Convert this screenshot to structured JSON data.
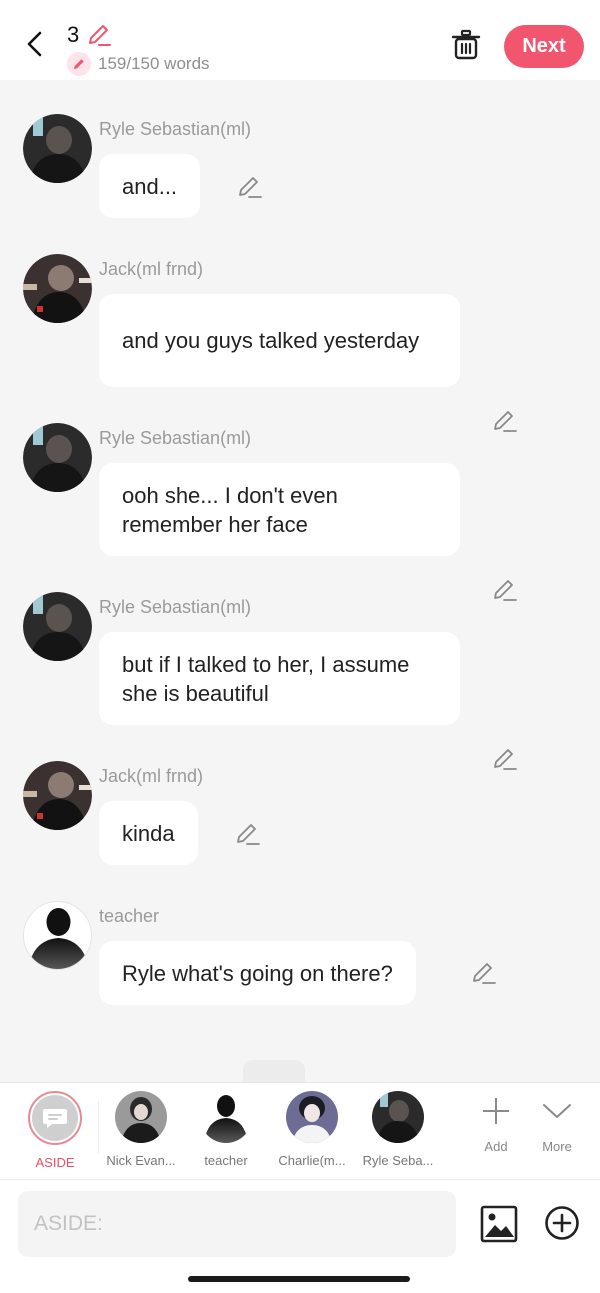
{
  "header": {
    "chapter_number": "3",
    "word_count": "159/150 words",
    "next_label": "Next"
  },
  "messages": [
    {
      "speaker": "Ryle Sebastian(ml)",
      "text": "and...",
      "avatar": "dark-figure-avatar"
    },
    {
      "speaker": "Jack(ml frnd)",
      "text": "and you guys talked yesterday",
      "avatar": "city-figure-avatar"
    },
    {
      "speaker": "Ryle Sebastian(ml)",
      "text": "ooh she... I don't even remember her face",
      "avatar": "dark-figure-avatar"
    },
    {
      "speaker": "Ryle Sebastian(ml)",
      "text": "but if I talked to her, I assume she is beautiful",
      "avatar": "dark-figure-avatar"
    },
    {
      "speaker": "Jack(ml frnd)",
      "text": "kinda",
      "avatar": "city-figure-avatar"
    },
    {
      "speaker": "teacher",
      "text": "Ryle what's going on there?",
      "avatar": "silhouette-avatar"
    }
  ],
  "characters": [
    {
      "label": "ASIDE",
      "selected": true
    },
    {
      "label": "Nick Evan..."
    },
    {
      "label": "teacher"
    },
    {
      "label": "Charlie(m..."
    },
    {
      "label": "Ryle Seba..."
    }
  ],
  "tools": {
    "add_label": "Add",
    "more_label": "More"
  },
  "input": {
    "placeholder": "ASIDE:"
  },
  "colors": {
    "accent": "#f2566f",
    "chat_background": "#f5f5f5"
  }
}
